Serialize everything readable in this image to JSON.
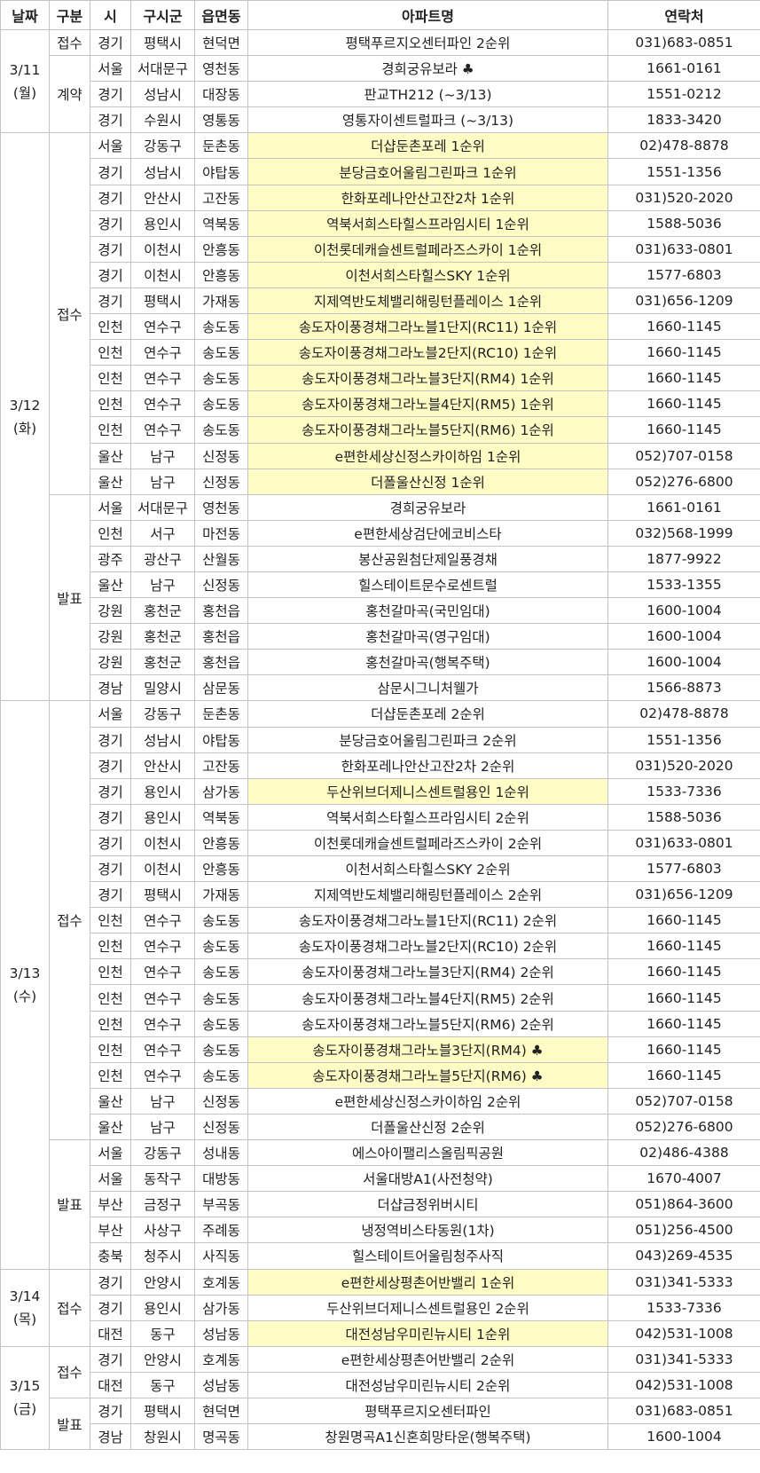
{
  "headers": [
    "날짜",
    "구분",
    "시",
    "구시군",
    "읍면동",
    "아파트명",
    "연락처"
  ],
  "groups": [
    {
      "date": "3/11",
      "day": "(월)",
      "sections": [
        {
          "type": "접수",
          "rows": [
            {
              "si": "경기",
              "gu": "평택시",
              "dong": "현덕면",
              "name": "평택푸르지오센터파인 2순위",
              "tel": "031)683-0851",
              "hl": false
            }
          ]
        },
        {
          "type": "계약",
          "rows": [
            {
              "si": "서울",
              "gu": "서대문구",
              "dong": "영천동",
              "name": "경희궁유보라 ♣",
              "tel": "1661-0161",
              "hl": false
            },
            {
              "si": "경기",
              "gu": "성남시",
              "dong": "대장동",
              "name": "판교TH212 (~3/13)",
              "tel": "1551-0212",
              "hl": false
            },
            {
              "si": "경기",
              "gu": "수원시",
              "dong": "영통동",
              "name": "영통자이센트럴파크 (~3/13)",
              "tel": "1833-3420",
              "hl": false
            }
          ]
        }
      ]
    },
    {
      "date": "3/12",
      "day": "(화)",
      "sections": [
        {
          "type": "접수",
          "rows": [
            {
              "si": "서울",
              "gu": "강동구",
              "dong": "둔촌동",
              "name": "더샵둔촌포레 1순위",
              "tel": "02)478-8878",
              "hl": true
            },
            {
              "si": "경기",
              "gu": "성남시",
              "dong": "야탑동",
              "name": "분당금호어울림그린파크 1순위",
              "tel": "1551-1356",
              "hl": true
            },
            {
              "si": "경기",
              "gu": "안산시",
              "dong": "고잔동",
              "name": "한화포레나안산고잔2차 1순위",
              "tel": "031)520-2020",
              "hl": true
            },
            {
              "si": "경기",
              "gu": "용인시",
              "dong": "역북동",
              "name": "역북서희스타힐스프라임시티 1순위",
              "tel": "1588-5036",
              "hl": true
            },
            {
              "si": "경기",
              "gu": "이천시",
              "dong": "안흥동",
              "name": "이천롯데캐슬센트럴페라즈스카이 1순위",
              "tel": "031)633-0801",
              "hl": true
            },
            {
              "si": "경기",
              "gu": "이천시",
              "dong": "안흥동",
              "name": "이천서희스타힐스SKY 1순위",
              "tel": "1577-6803",
              "hl": true
            },
            {
              "si": "경기",
              "gu": "평택시",
              "dong": "가재동",
              "name": "지제역반도체밸리해링턴플레이스 1순위",
              "tel": "031)656-1209",
              "hl": true
            },
            {
              "si": "인천",
              "gu": "연수구",
              "dong": "송도동",
              "name": "송도자이풍경채그라노블1단지(RC11) 1순위",
              "tel": "1660-1145",
              "hl": true
            },
            {
              "si": "인천",
              "gu": "연수구",
              "dong": "송도동",
              "name": "송도자이풍경채그라노블2단지(RC10) 1순위",
              "tel": "1660-1145",
              "hl": true
            },
            {
              "si": "인천",
              "gu": "연수구",
              "dong": "송도동",
              "name": "송도자이풍경채그라노블3단지(RM4) 1순위",
              "tel": "1660-1145",
              "hl": true
            },
            {
              "si": "인천",
              "gu": "연수구",
              "dong": "송도동",
              "name": "송도자이풍경채그라노블4단지(RM5) 1순위",
              "tel": "1660-1145",
              "hl": true
            },
            {
              "si": "인천",
              "gu": "연수구",
              "dong": "송도동",
              "name": "송도자이풍경채그라노블5단지(RM6) 1순위",
              "tel": "1660-1145",
              "hl": true
            },
            {
              "si": "울산",
              "gu": "남구",
              "dong": "신정동",
              "name": "e편한세상신정스카이하임 1순위",
              "tel": "052)707-0158",
              "hl": true
            },
            {
              "si": "울산",
              "gu": "남구",
              "dong": "신정동",
              "name": "더폴울산신정 1순위",
              "tel": "052)276-6800",
              "hl": true
            }
          ]
        },
        {
          "type": "발표",
          "rows": [
            {
              "si": "서울",
              "gu": "서대문구",
              "dong": "영천동",
              "name": "경희궁유보라",
              "tel": "1661-0161",
              "hl": false
            },
            {
              "si": "인천",
              "gu": "서구",
              "dong": "마전동",
              "name": "e편한세상검단에코비스타",
              "tel": "032)568-1999",
              "hl": false
            },
            {
              "si": "광주",
              "gu": "광산구",
              "dong": "산월동",
              "name": "봉산공원첨단제일풍경채",
              "tel": "1877-9922",
              "hl": false
            },
            {
              "si": "울산",
              "gu": "남구",
              "dong": "신정동",
              "name": "힐스테이트문수로센트럴",
              "tel": "1533-1355",
              "hl": false
            },
            {
              "si": "강원",
              "gu": "홍천군",
              "dong": "홍천읍",
              "name": "홍천갈마곡(국민임대)",
              "tel": "1600-1004",
              "hl": false
            },
            {
              "si": "강원",
              "gu": "홍천군",
              "dong": "홍천읍",
              "name": "홍천갈마곡(영구임대)",
              "tel": "1600-1004",
              "hl": false
            },
            {
              "si": "강원",
              "gu": "홍천군",
              "dong": "홍천읍",
              "name": "홍천갈마곡(행복주택)",
              "tel": "1600-1004",
              "hl": false
            },
            {
              "si": "경남",
              "gu": "밀양시",
              "dong": "삼문동",
              "name": "삼문시그니처웰가",
              "tel": "1566-8873",
              "hl": false
            }
          ]
        }
      ]
    },
    {
      "date": "3/13",
      "day": "(수)",
      "sections": [
        {
          "type": "접수",
          "rows": [
            {
              "si": "서울",
              "gu": "강동구",
              "dong": "둔촌동",
              "name": "더샵둔촌포레 2순위",
              "tel": "02)478-8878",
              "hl": false
            },
            {
              "si": "경기",
              "gu": "성남시",
              "dong": "야탑동",
              "name": "분당금호어울림그린파크 2순위",
              "tel": "1551-1356",
              "hl": false
            },
            {
              "si": "경기",
              "gu": "안산시",
              "dong": "고잔동",
              "name": "한화포레나안산고잔2차 2순위",
              "tel": "031)520-2020",
              "hl": false
            },
            {
              "si": "경기",
              "gu": "용인시",
              "dong": "삼가동",
              "name": "두산위브더제니스센트럴용인 1순위",
              "tel": "1533-7336",
              "hl": true
            },
            {
              "si": "경기",
              "gu": "용인시",
              "dong": "역북동",
              "name": "역북서희스타힐스프라임시티 2순위",
              "tel": "1588-5036",
              "hl": false
            },
            {
              "si": "경기",
              "gu": "이천시",
              "dong": "안흥동",
              "name": "이천롯데캐슬센트럴페라즈스카이 2순위",
              "tel": "031)633-0801",
              "hl": false
            },
            {
              "si": "경기",
              "gu": "이천시",
              "dong": "안흥동",
              "name": "이천서희스타힐스SKY 2순위",
              "tel": "1577-6803",
              "hl": false
            },
            {
              "si": "경기",
              "gu": "평택시",
              "dong": "가재동",
              "name": "지제역반도체밸리해링턴플레이스 2순위",
              "tel": "031)656-1209",
              "hl": false
            },
            {
              "si": "인천",
              "gu": "연수구",
              "dong": "송도동",
              "name": "송도자이풍경채그라노블1단지(RC11) 2순위",
              "tel": "1660-1145",
              "hl": false
            },
            {
              "si": "인천",
              "gu": "연수구",
              "dong": "송도동",
              "name": "송도자이풍경채그라노블2단지(RC10) 2순위",
              "tel": "1660-1145",
              "hl": false
            },
            {
              "si": "인천",
              "gu": "연수구",
              "dong": "송도동",
              "name": "송도자이풍경채그라노블3단지(RM4) 2순위",
              "tel": "1660-1145",
              "hl": false
            },
            {
              "si": "인천",
              "gu": "연수구",
              "dong": "송도동",
              "name": "송도자이풍경채그라노블4단지(RM5) 2순위",
              "tel": "1660-1145",
              "hl": false
            },
            {
              "si": "인천",
              "gu": "연수구",
              "dong": "송도동",
              "name": "송도자이풍경채그라노블5단지(RM6) 2순위",
              "tel": "1660-1145",
              "hl": false
            },
            {
              "si": "인천",
              "gu": "연수구",
              "dong": "송도동",
              "name": "송도자이풍경채그라노블3단지(RM4) ♣",
              "tel": "1660-1145",
              "hl": true
            },
            {
              "si": "인천",
              "gu": "연수구",
              "dong": "송도동",
              "name": "송도자이풍경채그라노블5단지(RM6) ♣",
              "tel": "1660-1145",
              "hl": true
            },
            {
              "si": "울산",
              "gu": "남구",
              "dong": "신정동",
              "name": "e편한세상신정스카이하임 2순위",
              "tel": "052)707-0158",
              "hl": false
            },
            {
              "si": "울산",
              "gu": "남구",
              "dong": "신정동",
              "name": "더폴울산신정 2순위",
              "tel": "052)276-6800",
              "hl": false
            }
          ]
        },
        {
          "type": "발표",
          "rows": [
            {
              "si": "서울",
              "gu": "강동구",
              "dong": "성내동",
              "name": "에스아이팰리스올림픽공원",
              "tel": "02)486-4388",
              "hl": false
            },
            {
              "si": "서울",
              "gu": "동작구",
              "dong": "대방동",
              "name": "서울대방A1(사전청약)",
              "tel": "1670-4007",
              "hl": false
            },
            {
              "si": "부산",
              "gu": "금정구",
              "dong": "부곡동",
              "name": "더샵금정위버시티",
              "tel": "051)864-3600",
              "hl": false
            },
            {
              "si": "부산",
              "gu": "사상구",
              "dong": "주례동",
              "name": "냉정역비스타동원(1차)",
              "tel": "051)256-4500",
              "hl": false
            },
            {
              "si": "충북",
              "gu": "청주시",
              "dong": "사직동",
              "name": "힐스테이트어울림청주사직",
              "tel": "043)269-4535",
              "hl": false
            }
          ]
        }
      ]
    },
    {
      "date": "3/14",
      "day": "(목)",
      "sections": [
        {
          "type": "접수",
          "rows": [
            {
              "si": "경기",
              "gu": "안양시",
              "dong": "호계동",
              "name": "e편한세상평촌어반밸리 1순위",
              "tel": "031)341-5333",
              "hl": true
            },
            {
              "si": "경기",
              "gu": "용인시",
              "dong": "삼가동",
              "name": "두산위브더제니스센트럴용인 2순위",
              "tel": "1533-7336",
              "hl": false
            },
            {
              "si": "대전",
              "gu": "동구",
              "dong": "성남동",
              "name": "대전성남우미린뉴시티 1순위",
              "tel": "042)531-1008",
              "hl": true
            }
          ]
        }
      ]
    },
    {
      "date": "3/15",
      "day": "(금)",
      "sections": [
        {
          "type": "접수",
          "rows": [
            {
              "si": "경기",
              "gu": "안양시",
              "dong": "호계동",
              "name": "e편한세상평촌어반밸리 2순위",
              "tel": "031)341-5333",
              "hl": false
            },
            {
              "si": "대전",
              "gu": "동구",
              "dong": "성남동",
              "name": "대전성남우미린뉴시티 2순위",
              "tel": "042)531-1008",
              "hl": false
            }
          ]
        },
        {
          "type": "발표",
          "rows": [
            {
              "si": "경기",
              "gu": "평택시",
              "dong": "현덕면",
              "name": "평택푸르지오센터파인",
              "tel": "031)683-0851",
              "hl": false
            },
            {
              "si": "경남",
              "gu": "창원시",
              "dong": "명곡동",
              "name": "창원명곡A1신혼희망타운(행복주택)",
              "tel": "1600-1004",
              "hl": false
            }
          ]
        }
      ]
    }
  ]
}
